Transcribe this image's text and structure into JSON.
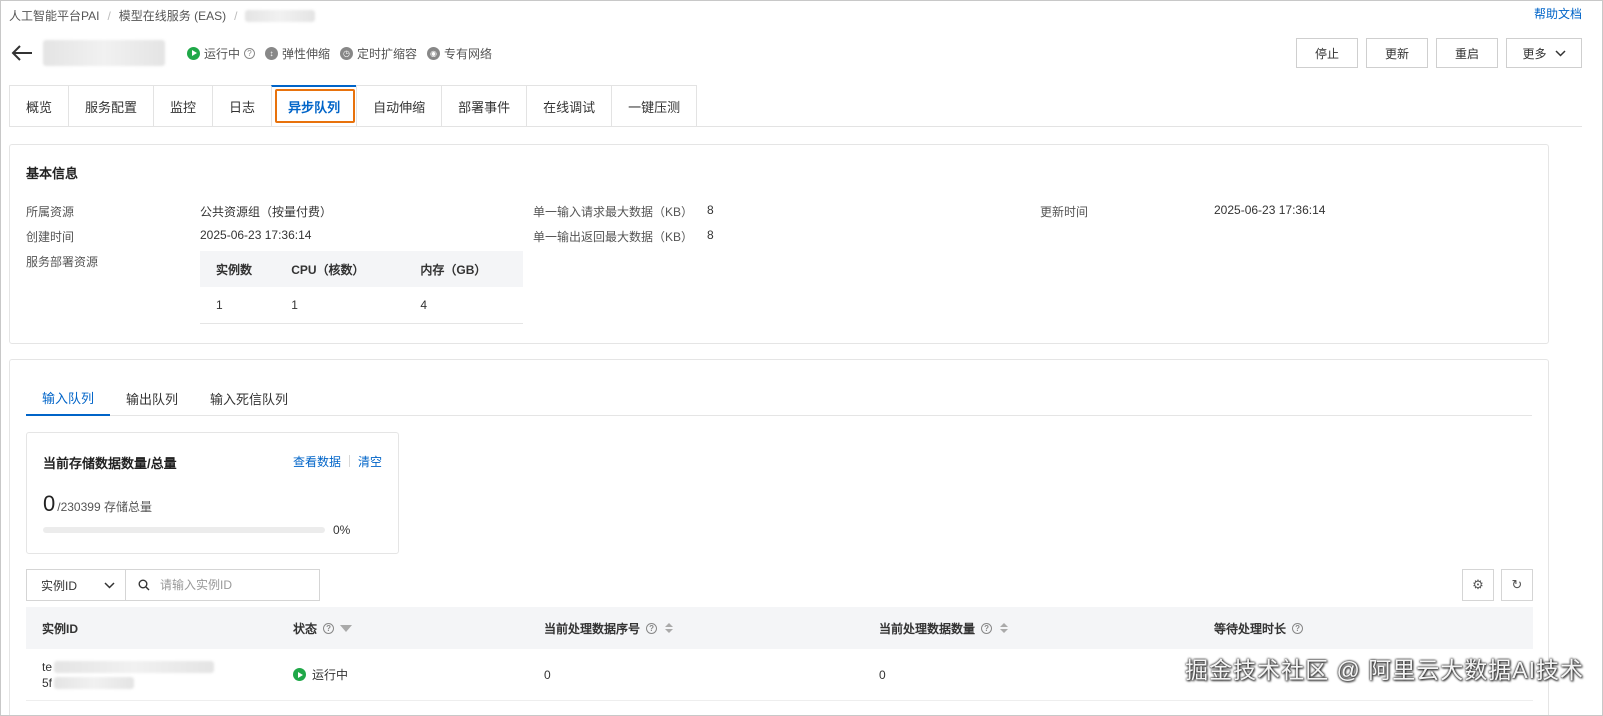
{
  "breadcrumb": {
    "items": [
      "人工智能平台PAI",
      "模型在线服务 (EAS)"
    ],
    "separator": "/"
  },
  "help": {
    "label": "帮助文档"
  },
  "header": {
    "statuses": [
      {
        "label": "运行中",
        "icon": "play-circle-icon"
      },
      {
        "label": "弹性伸缩",
        "icon": "scale-icon"
      },
      {
        "label": "定时扩缩容",
        "icon": "clock-icon"
      },
      {
        "label": "专有网络",
        "icon": "network-icon"
      }
    ],
    "actions": {
      "stop": "停止",
      "update": "更新",
      "restart": "重启",
      "more": "更多"
    }
  },
  "tabs": [
    "概览",
    "服务配置",
    "监控",
    "日志",
    "异步队列",
    "自动伸缩",
    "部署事件",
    "在线调试",
    "一键压测"
  ],
  "active_tab": "异步队列",
  "basic_info": {
    "title": "基本信息",
    "resource_label": "所属资源",
    "resource_value": "公共资源组（按量付费）",
    "created_label": "创建时间",
    "created_value": "2025-06-23 17:36:14",
    "deploy_label": "服务部署资源",
    "max_input_label": "单一输入请求最大数据（KB）",
    "max_input_value": "8",
    "max_output_label": "单一输出返回最大数据（KB）",
    "max_output_value": "8",
    "updated_label": "更新时间",
    "updated_value": "2025-06-23 17:36:14",
    "resource_table": {
      "headers": [
        "实例数",
        "CPU（核数）",
        "内存（GB）"
      ],
      "row": [
        "1",
        "1",
        "4"
      ]
    }
  },
  "queue": {
    "sub_tabs": [
      "输入队列",
      "输出队列",
      "输入死信队列"
    ],
    "active_sub_tab": "输入队列",
    "storage": {
      "title": "当前存储数据数量/总量",
      "view_link": "查看数据",
      "clear_link": "清空",
      "count": "0",
      "total": "/230399 存储总量",
      "percent": "0%",
      "progress": 0
    },
    "filter": {
      "select_value": "实例ID",
      "search_placeholder": "请输入实例ID"
    },
    "table": {
      "headers": {
        "instance_id": "实例ID",
        "status": "状态",
        "seq": "当前处理数据序号",
        "count": "当前处理数据数量",
        "wait": "等待处理时长"
      },
      "rows": [
        {
          "id_prefix_1": "te",
          "id_prefix_2": "5f",
          "status": "运行中",
          "seq": "0",
          "count": "0"
        }
      ]
    }
  },
  "watermark": "掘金技术社区 @ 阿里云大数据AI技术"
}
